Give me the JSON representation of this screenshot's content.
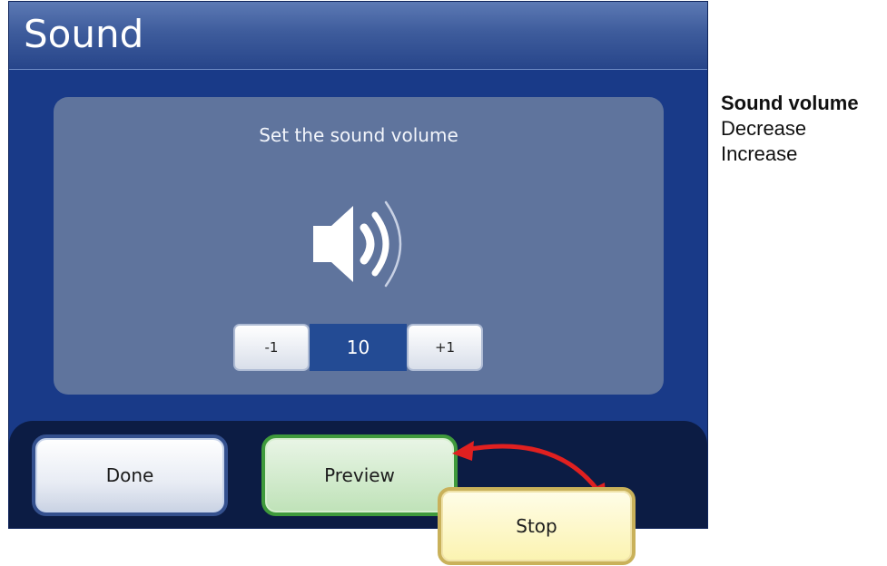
{
  "window": {
    "title": "Sound"
  },
  "panel": {
    "heading": "Set the sound volume",
    "speaker_icon": "speaker-volume-icon"
  },
  "volume": {
    "decrease_label": "-1",
    "value": "10",
    "increase_label": "+1"
  },
  "buttons": {
    "done_label": "Done",
    "preview_label": "Preview",
    "stop_label": "Stop"
  },
  "legend": {
    "title": "Sound volume",
    "items": [
      "Decrease",
      "Increase"
    ]
  },
  "colors": {
    "screen_bg": "#193a88",
    "panel_bg": "#5f749d",
    "done_border": "#34508e",
    "preview_border": "#3f9a3c",
    "stop_border": "#c9b15a",
    "arrow": "#e02020"
  }
}
